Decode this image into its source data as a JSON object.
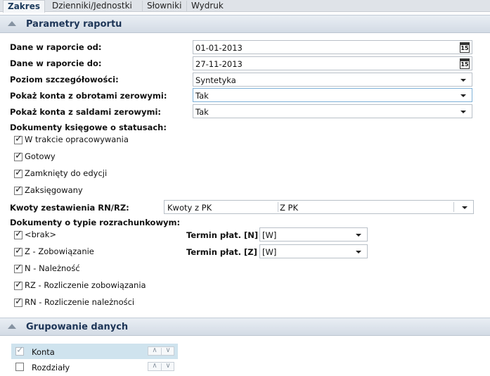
{
  "tabs": [
    "Zakres",
    "Dzienniki/Jednostki",
    "Słowniki",
    "Wydruk"
  ],
  "section1": {
    "title": "Parametry raportu"
  },
  "date_from": {
    "label": "Dane w raporcie od:",
    "value": "01-01-2013",
    "cal": "15"
  },
  "date_to": {
    "label": "Dane w raporcie do:",
    "value": "27-11-2013",
    "cal": "15"
  },
  "detail": {
    "label": "Poziom szczegółowości:",
    "value": "Syntetyka"
  },
  "zero_turnover": {
    "label": "Pokaż konta z obrotami zerowymi:",
    "value": "Tak"
  },
  "zero_balance": {
    "label": "Pokaż konta z saldami zerowymi:",
    "value": "Tak"
  },
  "statuses": {
    "label": "Dokumenty księgowe o statusach:",
    "items": [
      "W trakcie opracowywania",
      "Gotowy",
      "Zamknięty do edycji",
      "Zaksięgowany"
    ]
  },
  "rn_rz": {
    "label": "Kwoty zestawienia RN/RZ:",
    "value1": "Kwoty z PK",
    "value2": "Z PK"
  },
  "settlement": {
    "label": "Dokumenty o typie rozrachunkowym:",
    "items": [
      "<brak>",
      "Z - Zobowiązanie",
      "N - Należność",
      "RZ - Rozliczenie zobowiązania",
      "RN - Rozliczenie należności"
    ],
    "term_n_label": "Termin płat. [N]",
    "term_n_value": "[W]",
    "term_z_label": "Termin płat. [Z]",
    "term_z_value": "[W]"
  },
  "section2": {
    "title": "Grupowanie danych"
  },
  "grouping": [
    {
      "label": "Konta",
      "checked": true,
      "up": "∧",
      "down": "∨"
    },
    {
      "label": "Rozdziały",
      "checked": false,
      "up": "∧",
      "down": "∨"
    }
  ]
}
